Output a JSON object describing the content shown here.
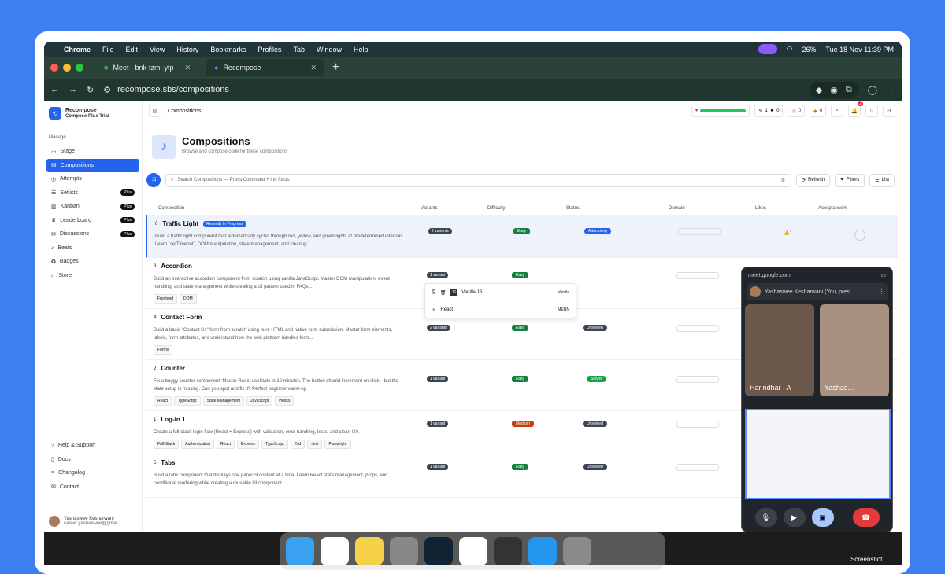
{
  "menubar": {
    "apple": "",
    "app": "Chrome",
    "items": [
      "File",
      "Edit",
      "View",
      "History",
      "Bookmarks",
      "Profiles",
      "Tab",
      "Window",
      "Help"
    ],
    "battery": "26%",
    "datetime": "Tue 18 Nov  11:39 PM"
  },
  "tabs": [
    {
      "label": "Meet - bnk-tzmi-ytp"
    },
    {
      "label": "Recompose"
    }
  ],
  "address": {
    "url": "recompose.sbs/compositions"
  },
  "sidebar": {
    "brand": "Recompose",
    "plan": "Compose Plus Trial",
    "section": "Manage",
    "items": [
      {
        "label": "Stage"
      },
      {
        "label": "Compositions"
      },
      {
        "label": "Attempts"
      },
      {
        "label": "Setlists",
        "badge": "Plus"
      },
      {
        "label": "Kanban",
        "badge": "Plus"
      },
      {
        "label": "Leaderboard",
        "badge": "Plus"
      },
      {
        "label": "Discussions",
        "badge": "Plus"
      },
      {
        "label": "Beats"
      },
      {
        "label": "Badges"
      },
      {
        "label": "Store"
      }
    ],
    "bottom": [
      {
        "label": "Help & Support"
      },
      {
        "label": "Docs"
      },
      {
        "label": "Changelog"
      },
      {
        "label": "Contact"
      }
    ],
    "user": {
      "name": "Yashaswee Kesharwani",
      "email": "career.yashaswee@gmai..."
    }
  },
  "topnav": {
    "breadcrumb": "Compositions",
    "stats": [
      "1",
      "0",
      "0",
      "0"
    ],
    "notif": "2"
  },
  "page": {
    "title": "Compositions",
    "subtitle": "Browse and compose code for these compositions"
  },
  "search": {
    "placeholder": "Search Compositions — Press Command + I to focus",
    "refresh": "Refresh",
    "filters": "Filters",
    "list": "List"
  },
  "table": {
    "headers": [
      "Composition",
      "Variants",
      "Difficulty",
      "Status",
      "Domain",
      "Likes",
      "Acceptance%"
    ],
    "rows": [
      {
        "n": "6",
        "title": "Traffic Light",
        "badge": "Recently In Progress",
        "desc": "Build a traffic light component that automatically cycles through red, yellow, and green lights at predetermined intervals. Learn `setTimeout`, DOM manipulation, state management, and cleanup...",
        "tags": [],
        "variants": "2 variants",
        "difficulty": "Easy",
        "status": "Attempting",
        "likes": "1"
      },
      {
        "n": "3",
        "title": "Accordion",
        "desc": "Build an interactive accordion component from scratch using vanilla JavaScript. Master DOM manipulation, event handling, and state management while creating a UI pattern used in FAQs,...",
        "tags": [
          "Frontend",
          "DOM"
        ],
        "variants": "1 variant",
        "difficulty": "Easy"
      },
      {
        "n": "4",
        "title": "Contact Form",
        "desc": "Build a basic \"Contact Us\" form from scratch using pure HTML and native form submission. Master form elements, labels, form attributes, and understand how the web platform handles form...",
        "tags": [
          "Forms"
        ],
        "variants": "2 variants",
        "difficulty": "Easy",
        "status": "Unsolved"
      },
      {
        "n": "2",
        "title": "Counter",
        "desc": "Fix a buggy counter component! Master React useState in 10 minutes. The button should increment on click—but the state setup is missing. Can you spot and fix it? Perfect beginner warm-up.",
        "tags": [
          "React",
          "TypeScript",
          "State Management",
          "JavaScript",
          "Hooks"
        ],
        "variants": "1 variant",
        "difficulty": "Easy",
        "status": "Solved"
      },
      {
        "n": "1",
        "title": "Log-in 1",
        "desc": "Create a full-stack login flow (React + Express) with validation, error handling, tests, and clean UX.",
        "tags": [
          "Full-Stack",
          "Authentication",
          "React",
          "Express",
          "TypeScript",
          "Zod",
          "Jest",
          "Playwright"
        ],
        "variants": "1 variant",
        "difficulty": "Medium",
        "status": "Unsolved"
      },
      {
        "n": "5",
        "title": "Tabs",
        "desc": "Build a tabs component that displays one panel of content at a time. Learn React state management, props, and conditional rendering while creating a reusable UI component.",
        "tags": [],
        "variants": "1 variant",
        "difficulty": "Easy",
        "status": "Unsolved"
      }
    ]
  },
  "popup": {
    "items": [
      {
        "label": "Vanilla JS",
        "tag": "Vanilla"
      },
      {
        "label": "React",
        "tag": "MERN"
      }
    ]
  },
  "meet": {
    "title": "Meet - bnk-tzmi-ytp",
    "url": "meet.google.com",
    "presenter": "Yashaswee Kesharwani (You, pres...",
    "tiles": [
      "Harindhar . A",
      "Yashas..."
    ]
  },
  "screenshot_label": "Screenshot",
  "colors": {
    "accent": "#2463eb",
    "easy": "#15803d",
    "medium": "#c2410c",
    "attempting": "#2463eb",
    "unsolved": "#3b4452",
    "solved": "#16a34a"
  }
}
